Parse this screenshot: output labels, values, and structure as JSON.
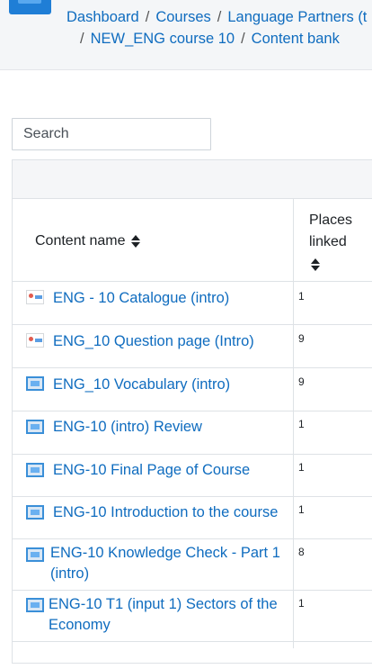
{
  "breadcrumb": {
    "line1": [
      "Dashboard",
      "Courses",
      "Language Partners (t"
    ],
    "line2": [
      "NEW_ENG course 10",
      "Content bank"
    ],
    "separator": "/"
  },
  "search": {
    "placeholder": "Search",
    "value": ""
  },
  "table": {
    "col_name": "Content name",
    "col_places": "Places linked",
    "rows": [
      {
        "name": "ENG - 10 Catalogue (intro)",
        "places": "1",
        "icon": "h5p-icon"
      },
      {
        "name": "ENG_10 Question page (Intro)",
        "places": "9",
        "icon": "h5p-icon"
      },
      {
        "name": "ENG_10 Vocabulary (intro)",
        "places": "9",
        "icon": "book-icon"
      },
      {
        "name": "ENG-10 (intro) Review",
        "places": "1",
        "icon": "book-icon"
      },
      {
        "name": "ENG-10 Final Page of Course",
        "places": "1",
        "icon": "book-icon"
      },
      {
        "name": "ENG-10 Introduction to the course",
        "places": "1",
        "icon": "book-icon"
      },
      {
        "name": "ENG-10 Knowledge Check - Part 1 (intro)",
        "places": "8",
        "icon": "book-icon"
      },
      {
        "name": "ENG-10 T1 (input 1) Sectors of the Economy",
        "places": "1",
        "icon": "book-icon"
      }
    ]
  },
  "colors": {
    "link": "#0f6cbf",
    "border": "#dee2e6",
    "header_bg": "#f4f6f8"
  }
}
